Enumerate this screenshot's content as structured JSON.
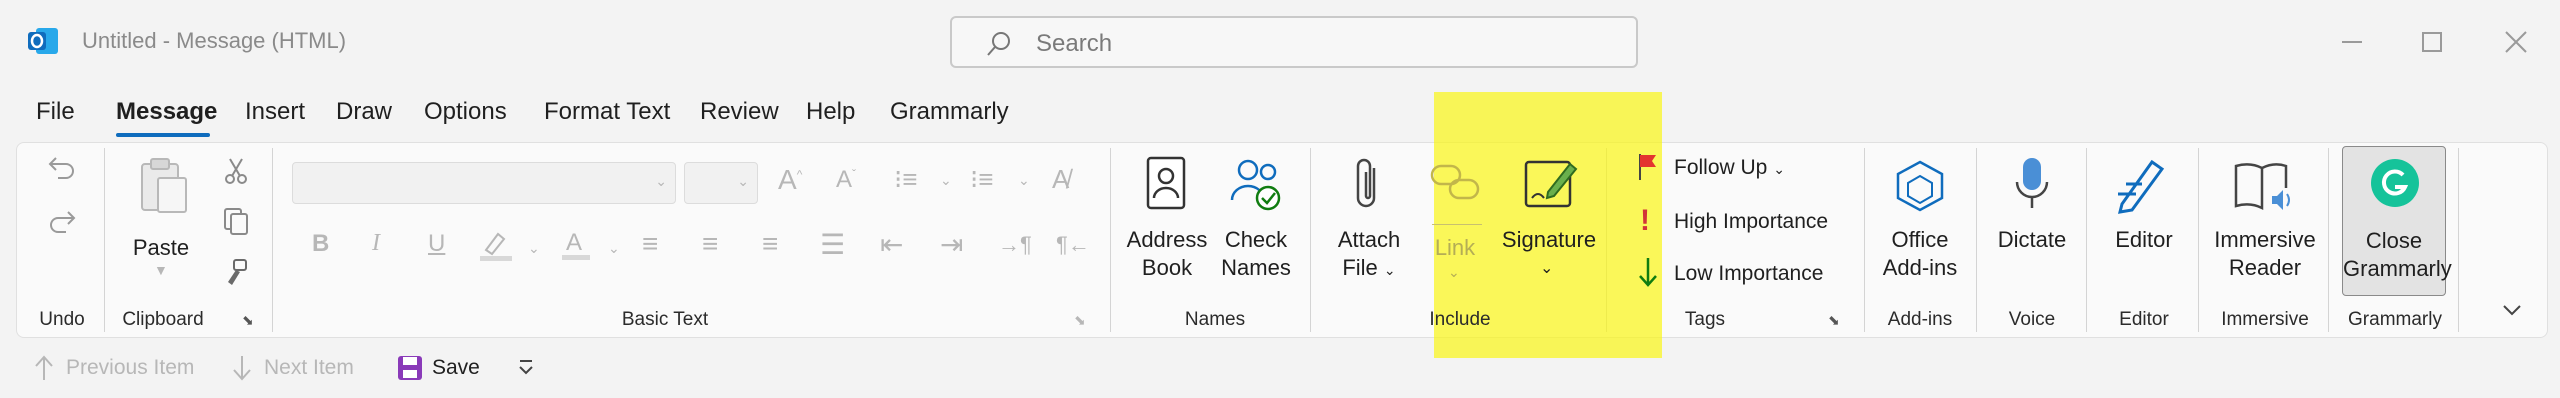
{
  "window": {
    "title": "Untitled  -  Message (HTML)"
  },
  "search": {
    "placeholder": "Search"
  },
  "tabs": [
    "File",
    "Message",
    "Insert",
    "Draw",
    "Options",
    "Format Text",
    "Review",
    "Help",
    "Grammarly"
  ],
  "active_tab": "Message",
  "groups": {
    "undo": "Undo",
    "clipboard": "Clipboard",
    "basic_text": "Basic Text",
    "names": "Names",
    "include": "Include",
    "tags": "Tags",
    "addins": "Add-ins",
    "voice": "Voice",
    "editor": "Editor",
    "immersive": "Immersive",
    "grammarly": "Grammarly"
  },
  "buttons": {
    "paste": "Paste",
    "address_book": [
      "Address",
      "Book"
    ],
    "check_names": [
      "Check",
      "Names"
    ],
    "attach_file": [
      "Attach",
      "File"
    ],
    "link": "Link",
    "signature": "Signature",
    "follow_up": "Follow Up",
    "high_importance": "High Importance",
    "low_importance": "Low Importance",
    "office_addins": [
      "Office",
      "Add-ins"
    ],
    "dictate": "Dictate",
    "editor": "Editor",
    "immersive_reader": [
      "Immersive",
      "Reader"
    ],
    "close_grammarly": [
      "Close",
      "Grammarly"
    ]
  },
  "format_buttons": {
    "bold": "B",
    "italic": "I",
    "underline": "U"
  },
  "qat": {
    "previous_item": "Previous Item",
    "next_item": "Next Item",
    "save": "Save"
  },
  "colors": {
    "accent": "#0f6cbd",
    "highlight": "#f5f000",
    "flag": "#e3342f",
    "important": "#d13438",
    "low_arrow": "#107c10",
    "grammarly": "#15c39a"
  },
  "icons": {
    "app": "outlook-icon",
    "search": "search-icon",
    "undo": "undo-icon",
    "redo": "redo-icon",
    "paste": "clipboard-icon",
    "cut": "scissors-icon",
    "copy": "copy-icon",
    "format_painter": "brush-icon",
    "address_book": "address-book-icon",
    "check_names": "people-check-icon",
    "attach": "paperclip-icon",
    "link": "link-icon",
    "signature": "signature-pen-icon",
    "flag": "flag-icon",
    "exclamation": "exclamation-icon",
    "down_arrow": "down-arrow-icon",
    "addins": "hexagon-icon",
    "mic": "microphone-icon",
    "editor": "editor-pen-icon",
    "reader": "book-speaker-icon",
    "grammarly": "grammarly-icon",
    "save": "save-icon"
  }
}
